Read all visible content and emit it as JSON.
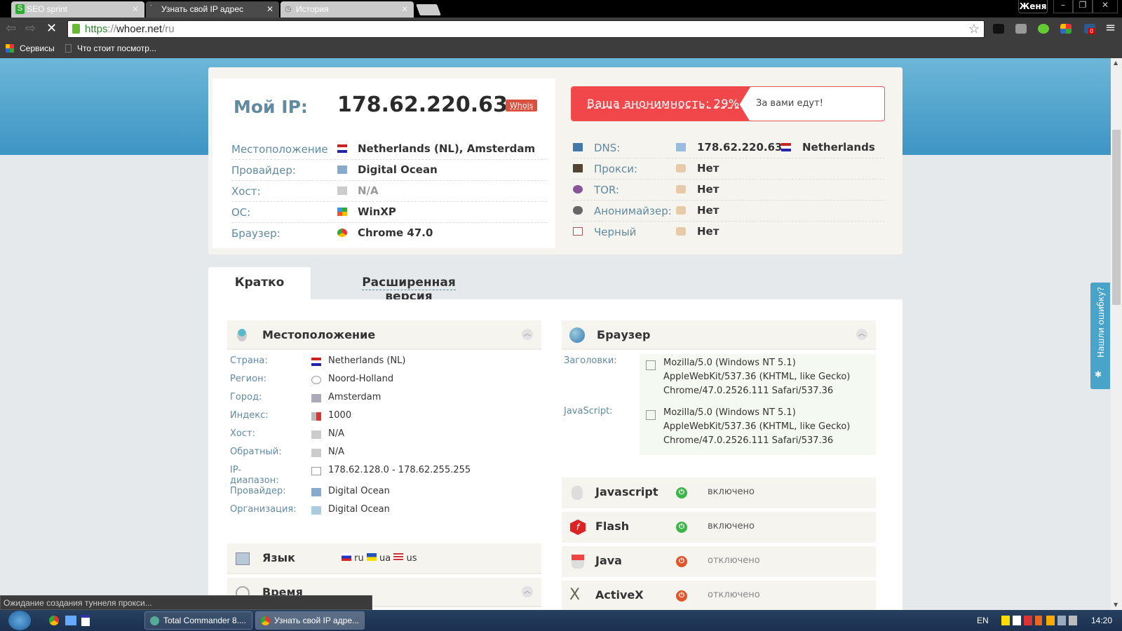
{
  "browser": {
    "tabs": [
      {
        "label": "SEO sprint"
      },
      {
        "label": "Узнать свой IP адрес"
      },
      {
        "label": "История"
      }
    ],
    "user": "Женя",
    "url_scheme": "https",
    "url_sep": "://",
    "url_domain": "whoer.net",
    "url_path": "/ru",
    "bookmarks": [
      {
        "label": "Сервисы"
      },
      {
        "label": "Что стоит посмотр..."
      }
    ],
    "extension_badge": "0",
    "status_text": "Ожидание создания туннеля прокси..."
  },
  "summary": {
    "my_ip_label": "Мой IP:",
    "ip": "178.62.220.63",
    "whois": "Whois",
    "rows": [
      {
        "label": "Местоположение",
        "value": "Netherlands (NL), Amsterdam"
      },
      {
        "label": "Провайдер:",
        "value": "Digital Ocean"
      },
      {
        "label": "Хост:",
        "value": "N/A"
      },
      {
        "label": "ОС:",
        "value": "WinXP"
      },
      {
        "label": "Браузер:",
        "value": "Chrome 47.0"
      }
    ],
    "anonymity": "Ваша анонимность: 29%",
    "anonymity_percent": 29,
    "anonymity_message": "За вами едут!",
    "checks": [
      {
        "label": "DNS:",
        "value": "178.62.220.63",
        "country": "Netherlands"
      },
      {
        "label": "Прокси:",
        "value": "Нет"
      },
      {
        "label": "TOR:",
        "value": "Нет"
      },
      {
        "label": "Анонимайзер:",
        "value": "Нет"
      },
      {
        "label": "Черный",
        "value": "Нет"
      }
    ]
  },
  "tabs": {
    "short": "Кратко",
    "extended": "Расширенная версия"
  },
  "location": {
    "title": "Местоположение",
    "rows": [
      {
        "label": "Страна:",
        "value": "Netherlands (NL)"
      },
      {
        "label": "Регион:",
        "value": "Noord-Holland"
      },
      {
        "label": "Город:",
        "value": "Amsterdam"
      },
      {
        "label": "Индекс:",
        "value": "1000"
      },
      {
        "label": "Хост:",
        "value": "N/A"
      },
      {
        "label": "Обратный:",
        "value": "N/A"
      },
      {
        "label": "IP-диапазон:",
        "value": "178.62.128.0 - 178.62.255.255"
      },
      {
        "label": "Провайдер:",
        "value": "Digital Ocean"
      },
      {
        "label": "Организация:",
        "value": "Digital Ocean"
      }
    ]
  },
  "language": {
    "title": "Язык",
    "langs": [
      "ru",
      "ua",
      "us"
    ]
  },
  "time": {
    "title": "Время"
  },
  "browser_section": {
    "title": "Браузер",
    "headers_label": "Заголовки:",
    "headers": [
      "Mozilla/5.0 (Windows NT 5.1)",
      "AppleWebKit/537.36 (KHTML, like Gecko)",
      "Chrome/47.0.2526.111 Safari/537.36"
    ],
    "js_label": "JavaScript:",
    "js": [
      "Mozilla/5.0 (Windows NT 5.1)",
      "AppleWebKit/537.36 (KHTML, like Gecko)",
      "Chrome/47.0.2526.111 Safari/537.36"
    ]
  },
  "plugins": [
    {
      "name": "Javascript",
      "status": "включено"
    },
    {
      "name": "Flash",
      "status": "включено"
    },
    {
      "name": "Java",
      "status": "отключено"
    },
    {
      "name": "ActiveX",
      "status": "отключено"
    }
  ],
  "colors": {
    "on": "#3cb54a",
    "off": "#e0552b",
    "accent": "#f2474a"
  },
  "feedback": "Нашли ошибку?",
  "taskbar": {
    "items": [
      {
        "label": "Total Commander 8...."
      },
      {
        "label": "Узнать свой IP адре..."
      }
    ],
    "lang": "EN",
    "clock": "14:20"
  }
}
